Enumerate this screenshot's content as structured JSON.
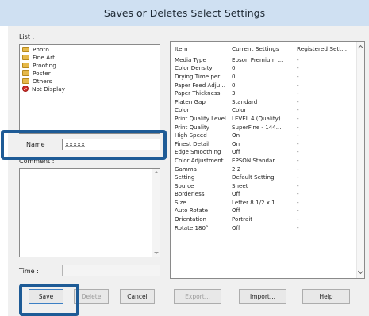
{
  "window": {
    "title": "Saves or Deletes Select Settings"
  },
  "list": {
    "label": "List :",
    "items": [
      {
        "label": "Photo",
        "icon": "folder-icon"
      },
      {
        "label": "Fine Art",
        "icon": "folder-icon"
      },
      {
        "label": "Proofing",
        "icon": "folder-icon"
      },
      {
        "label": "Poster",
        "icon": "folder-icon"
      },
      {
        "label": "Others",
        "icon": "folder-icon"
      },
      {
        "label": "Not Display",
        "icon": "not-display-icon"
      }
    ]
  },
  "name": {
    "label": "Name :",
    "value": "XXXXX"
  },
  "comment": {
    "label": "Comment :"
  },
  "time": {
    "label": "Time :",
    "value": ""
  },
  "table": {
    "headers": [
      "Item",
      "Current Settings",
      "Registered Sett..."
    ],
    "rows": [
      [
        "Media Type",
        "Epson Premium ...",
        "-"
      ],
      [
        "Color Density",
        "0",
        "-"
      ],
      [
        "Drying Time per ...",
        "0",
        "-"
      ],
      [
        "Paper Feed Adju...",
        "0",
        "-"
      ],
      [
        "Paper Thickness",
        "3",
        "-"
      ],
      [
        "Platen Gap",
        "Standard",
        "-"
      ],
      [
        "Color",
        "Color",
        "-"
      ],
      [
        "Print Quality Level",
        "LEVEL 4 (Quality)",
        "-"
      ],
      [
        "Print Quality",
        "SuperFine - 144...",
        "-"
      ],
      [
        "High Speed",
        "On",
        "-"
      ],
      [
        "Finest Detail",
        "On",
        "-"
      ],
      [
        "Edge Smoothing",
        "Off",
        "-"
      ],
      [
        "Color Adjustment",
        "EPSON Standar...",
        "-"
      ],
      [
        "Gamma",
        "2.2",
        "-"
      ],
      [
        "Setting",
        "Default Setting",
        "-"
      ],
      [
        "Source",
        "Sheet",
        "-"
      ],
      [
        "Borderless",
        "Off",
        "-"
      ],
      [
        "Size",
        "Letter 8 1/2 x 1...",
        "-"
      ],
      [
        "Auto Rotate",
        "Off",
        "-"
      ],
      [
        "Orientation",
        "Portrait",
        "-"
      ],
      [
        "Rotate 180°",
        "Off",
        "-"
      ]
    ]
  },
  "buttons": {
    "save": "Save",
    "delete": "Delete",
    "cancel": "Cancel",
    "export": "Export...",
    "import": "Import...",
    "help": "Help"
  },
  "colors": {
    "titlebar": "#cfe0f2",
    "dialog": "#f0f0f0",
    "highlight": "#1e5b96"
  }
}
